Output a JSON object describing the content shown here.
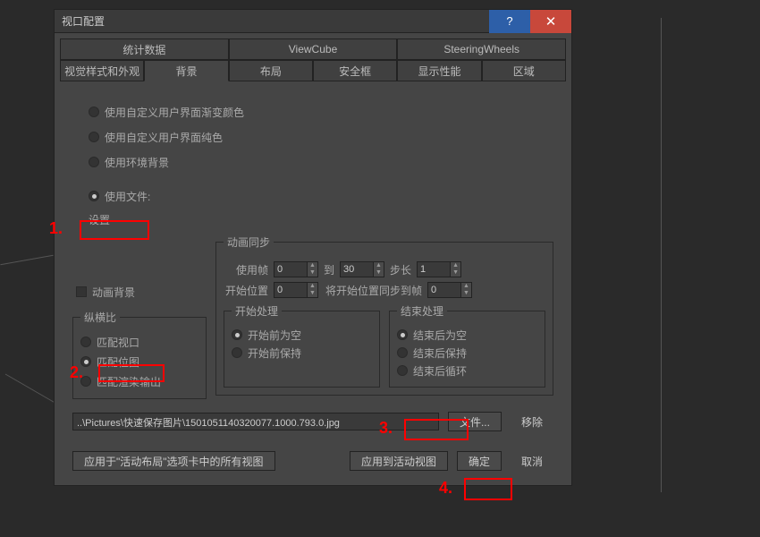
{
  "dialog": {
    "title": "视口配置"
  },
  "tabs": {
    "row1": [
      "统计数据",
      "ViewCube",
      "SteeringWheels"
    ],
    "row2": [
      "视觉样式和外观",
      "背景",
      "布局",
      "安全框",
      "显示性能",
      "区域"
    ],
    "active": "背景"
  },
  "radios": {
    "custom_gradient": "使用自定义用户界面渐变颜色",
    "custom_solid": "使用自定义用户界面纯色",
    "env_bg": "使用环境背景",
    "use_file": "使用文件:"
  },
  "settings": {
    "label": "设置",
    "anim_bg": "动画背景"
  },
  "aspect": {
    "legend": "纵横比",
    "match_viewport": "匹配视口",
    "match_bitmap": "匹配位图",
    "match_render": "匹配渲染输出"
  },
  "anim_sync": {
    "legend": "动画同步",
    "use_frame": "使用帧",
    "use_frame_val": "0",
    "to": "到",
    "to_val": "30",
    "step": "步长",
    "step_val": "1",
    "start_pos": "开始位置",
    "start_pos_val": "0",
    "sync_start": "将开始位置同步到帧",
    "sync_start_val": "0"
  },
  "start_proc": {
    "legend": "开始处理",
    "blank_before": "开始前为空",
    "hold_before": "开始前保持"
  },
  "end_proc": {
    "legend": "结束处理",
    "blank_after": "结束后为空",
    "hold_after": "结束后保持",
    "loop_after": "结束后循环"
  },
  "file": {
    "path": "..\\Pictures\\快速保存图片\\1501051140320077.1000.793.0.jpg",
    "file_btn": "文件...",
    "remove_btn": "移除"
  },
  "bottom": {
    "apply_all": "应用于\"活动布局\"选项卡中的所有视图",
    "apply_active": "应用到活动视图",
    "ok": "确定",
    "cancel": "取消"
  },
  "annotations": {
    "n1": "1.",
    "n2": "2.",
    "n3": "3.",
    "n4": "4."
  }
}
